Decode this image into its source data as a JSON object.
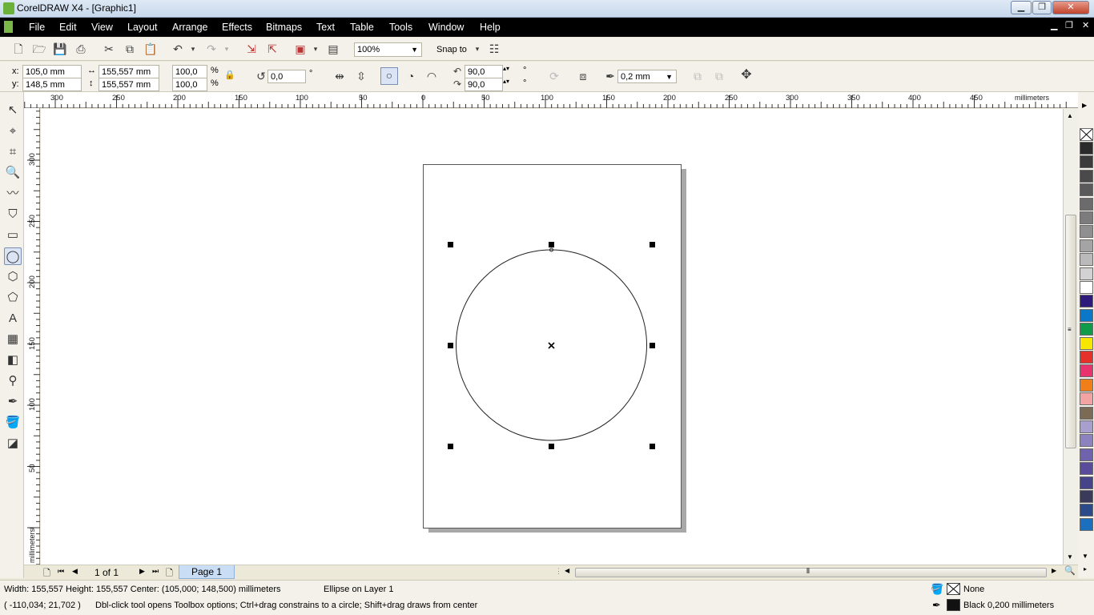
{
  "window": {
    "title": "CorelDRAW X4 - [Graphic1]"
  },
  "menu": [
    "File",
    "Edit",
    "View",
    "Layout",
    "Arrange",
    "Effects",
    "Bitmaps",
    "Text",
    "Table",
    "Tools",
    "Window",
    "Help"
  ],
  "standard_bar": {
    "zoom": "100%",
    "snap_to": "Snap to"
  },
  "property_bar": {
    "x_label": "x:",
    "x": "105,0 mm",
    "y_label": "y:",
    "y": "148,5 mm",
    "width": "155,557 mm",
    "height": "155,557 mm",
    "scale_w": "100,0",
    "scale_h": "100,0",
    "pct": "%",
    "rotation": "0,0",
    "deg": "°",
    "start_angle": "90,0",
    "end_angle": "90,0",
    "outline_width": "0,2 mm"
  },
  "rulers": {
    "h_labels": [
      "300",
      "250",
      "200",
      "150",
      "100",
      "50",
      "0",
      "50",
      "100",
      "150",
      "200",
      "250",
      "300",
      "350",
      "400",
      "450"
    ],
    "h_unit": "millimeters",
    "v_labels": [
      "300",
      "250",
      "200",
      "150",
      "100",
      "50",
      "0"
    ],
    "v_unit": "millimeters"
  },
  "page_nav": {
    "counter": "1 of 1",
    "tab": "Page 1"
  },
  "status": {
    "line1": "Width: 155,557  Height: 155,557  Center: (105,000; 148,500)  millimeters",
    "object": "Ellipse on Layer 1",
    "coords": "( -110,034; 21,702 )",
    "hint": "Dbl-click tool opens Toolbox options; Ctrl+drag constrains to a circle; Shift+drag draws from center",
    "fill": "None",
    "outline": "Black  0,200 millimeters"
  },
  "palette": [
    "#2b2b2b",
    "#3b3b3b",
    "#4a4a4a",
    "#5a5a5a",
    "#6b6b6b",
    "#7c7c7c",
    "#8f8f8f",
    "#a4a4a4",
    "#bababa",
    "#d2d2d2",
    "#ffffff",
    "#2e1a7a",
    "#0a77c9",
    "#0f9b4a",
    "#f7e600",
    "#e6312a",
    "#e8336f",
    "#f07f1a",
    "#f4a3a3",
    "#7b6a54",
    "#a89fcf",
    "#8c82c0",
    "#6f63ae",
    "#5a4b9c",
    "#45448b",
    "#3a3a5a",
    "#2b4a8a",
    "#1a6fbf"
  ],
  "colors": {
    "menubar": "#000000",
    "page": "#ffffff"
  }
}
